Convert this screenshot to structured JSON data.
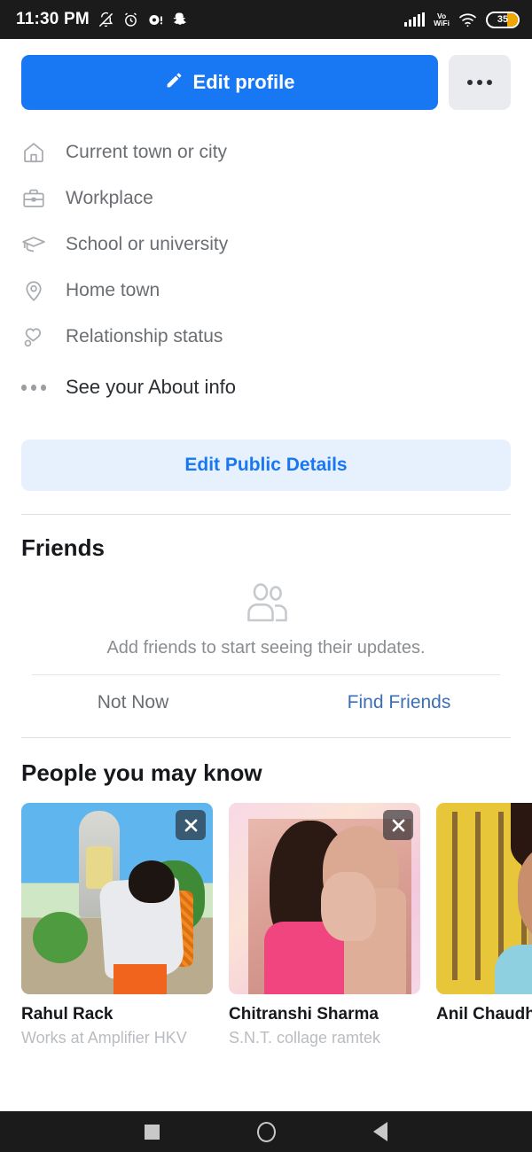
{
  "status_bar": {
    "time": "11:30 PM",
    "left_icons": [
      "bell-off-icon",
      "alarm-icon",
      "message-dot-icon",
      "snapchat-icon"
    ],
    "network_label": "Vo\nWiFi",
    "network_line1": "Vo",
    "network_line2": "WiFi",
    "battery_percent": "35",
    "right_icons": [
      "signal-bars-icon",
      "volte-wifi-icon",
      "wifi-icon",
      "battery-icon"
    ],
    "background": "#1b1b1b"
  },
  "actions": {
    "edit_profile_label": "Edit profile",
    "edit_profile_icon": "pencil-icon",
    "more_icon": "ellipsis-icon",
    "primary_color": "#1877f2",
    "more_bg": "#e9ebee"
  },
  "about": {
    "rows": [
      {
        "icon": "home-icon",
        "label": "Current town or city"
      },
      {
        "icon": "briefcase-icon",
        "label": "Workplace"
      },
      {
        "icon": "graduation-cap-icon",
        "label": "School or university"
      },
      {
        "icon": "location-pin-icon",
        "label": "Home town"
      },
      {
        "icon": "heart-icon",
        "label": "Relationship status"
      }
    ],
    "see_about_label": "See your About info",
    "see_about_icon": "ellipsis-icon",
    "edit_public_details_label": "Edit Public Details",
    "edit_public_details_bg": "#e7f0fd",
    "edit_public_details_color": "#1877f2"
  },
  "friends": {
    "title": "Friends",
    "empty_icon": "people-icon",
    "empty_message": "Add friends to start seeing their updates.",
    "not_now_label": "Not Now",
    "find_friends_label": "Find Friends",
    "find_friends_color": "#3b6fb6"
  },
  "people_you_may_know": {
    "title": "People you may know",
    "close_icon": "close-icon",
    "cards": [
      {
        "name": "Rahul Rack",
        "subtitle": "Works at Amplifier HKV"
      },
      {
        "name": "Chitranshi Sharma",
        "subtitle": "S.N.T. collage ramtek"
      },
      {
        "name": "Anil Chaudha",
        "subtitle": ""
      }
    ]
  },
  "nav_bar": {
    "buttons": [
      "recents-button",
      "home-button",
      "back-button"
    ],
    "background": "#1b1b1b"
  }
}
